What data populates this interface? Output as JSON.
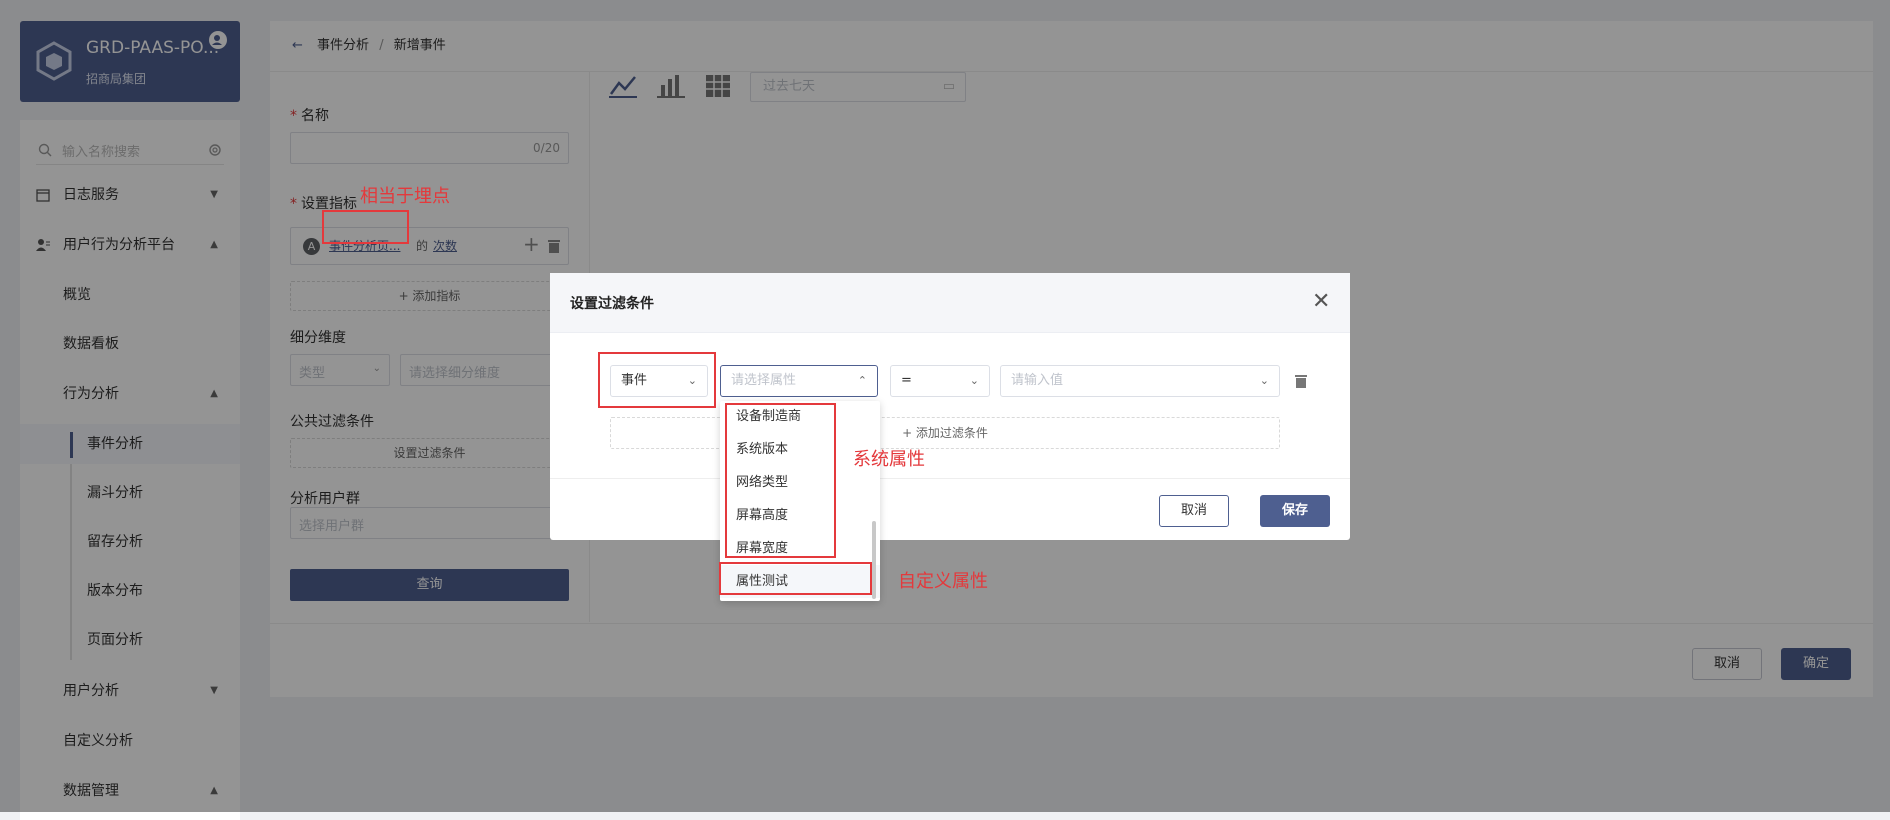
{
  "brand": {
    "title": "GRD-PAAS-PO...",
    "subtitle": "招商局集团"
  },
  "sidebar": {
    "search_placeholder": "输入名称搜索",
    "items": [
      {
        "label": "日志服务"
      },
      {
        "label": "用户行为分析平台"
      },
      {
        "label": "概览"
      },
      {
        "label": "数据看板"
      },
      {
        "label": "行为分析"
      },
      {
        "label": "事件分析"
      },
      {
        "label": "漏斗分析"
      },
      {
        "label": "留存分析"
      },
      {
        "label": "版本分布"
      },
      {
        "label": "页面分析"
      },
      {
        "label": "用户分析"
      },
      {
        "label": "自定义分析"
      },
      {
        "label": "数据管理"
      }
    ]
  },
  "breadcrumb": {
    "back": "←",
    "parent": "事件分析",
    "sep": "/",
    "current": "新增事件"
  },
  "form": {
    "name_label": "名称",
    "name_counter": "0/20",
    "metric_label": "设置指标",
    "metric_badge": "A",
    "metric_event": "事件分析页...",
    "metric_of": "的",
    "metric_count": "次数",
    "add_metric": "+ 添加指标",
    "dimension_label": "细分维度",
    "dimension_type_placeholder": "类型",
    "dimension_placeholder": "请选择细分维度",
    "filter_label": "公共过滤条件",
    "filter_button": "设置过滤条件",
    "group_label": "分析用户群",
    "group_placeholder": "选择用户群",
    "query_button": "查询"
  },
  "toolbar": {
    "date_placeholder": "过去七天"
  },
  "footer": {
    "cancel": "取消",
    "confirm": "确定"
  },
  "modal": {
    "title": "设置过滤条件",
    "type_value": "事件",
    "attr_placeholder": "请选择属性",
    "operator_value": "=",
    "value_placeholder": "请输入值",
    "add_condition": "+ 添加过滤条件",
    "cancel": "取消",
    "save": "保存"
  },
  "dropdown": {
    "items": [
      "设备制造商",
      "系统版本",
      "网络类型",
      "屏幕高度",
      "屏幕宽度",
      "属性测试"
    ]
  },
  "annotations": {
    "buried_point": "相当于埋点",
    "system_attr": "系统属性",
    "custom_attr": "自定义属性"
  },
  "colors": {
    "brand": "#4e5f90",
    "annotation": "#e4393c"
  }
}
